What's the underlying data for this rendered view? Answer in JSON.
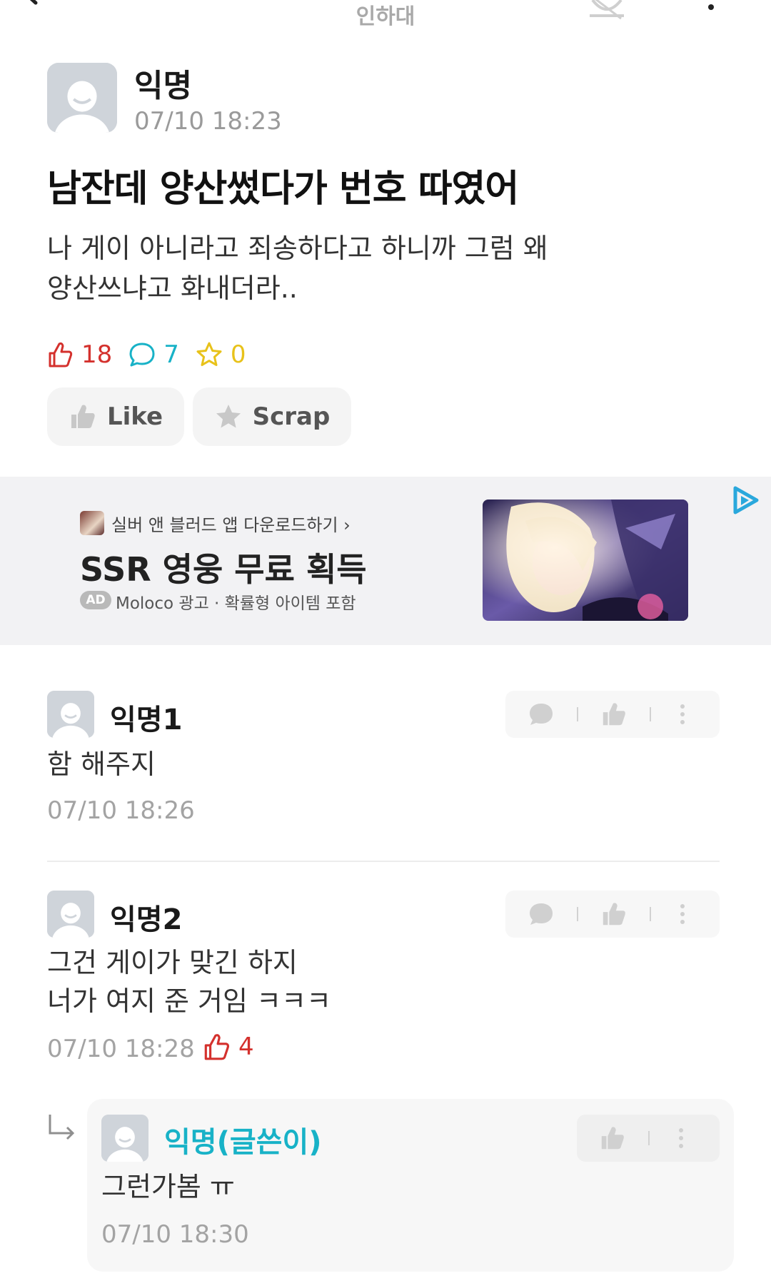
{
  "topbar": {
    "board_title": "인하대",
    "back_icon": "back-arrow-icon",
    "bell_icon": "bell-off-icon",
    "more_icon": "more-vertical-icon"
  },
  "post": {
    "author": "익명",
    "timestamp": "07/10 18:23",
    "title": "남잔데 양산썼다가 번호 따였어",
    "body_lines": [
      "나 게이 아니라고 죄송하다고 하니까 그럼 왜",
      "양산쓰냐고 화내더라.."
    ],
    "likes": "18",
    "comments": "7",
    "scraps": "0",
    "like_button": "Like",
    "scrap_button": "Scrap"
  },
  "ad": {
    "download_text": "실버 앤 블러드 앱 다운로드하기 ›",
    "headline": "SSR 영웅 무료 획득",
    "badge": "AD",
    "disclaimer": "Moloco 광고 · 확률형 아이템 포함"
  },
  "comments": [
    {
      "author": "익명1",
      "lines": [
        "함 해주지"
      ],
      "timestamp": "07/10 18:26"
    },
    {
      "author": "익명2",
      "lines": [
        "그건 게이가 맞긴 하지",
        "너가 여지 준 거임 ㅋㅋㅋ"
      ],
      "timestamp": "07/10 18:28",
      "likes": "4"
    }
  ],
  "reply": {
    "author": "익명(글쓴이)",
    "lines": [
      "그런가봄 ㅠ"
    ],
    "timestamp": "07/10 18:30"
  },
  "colors": {
    "like_red": "#d4312d",
    "comment_teal": "#18b2c7",
    "scrap_yellow": "#e8c21a",
    "muted_gray": "#a3a3a3"
  }
}
